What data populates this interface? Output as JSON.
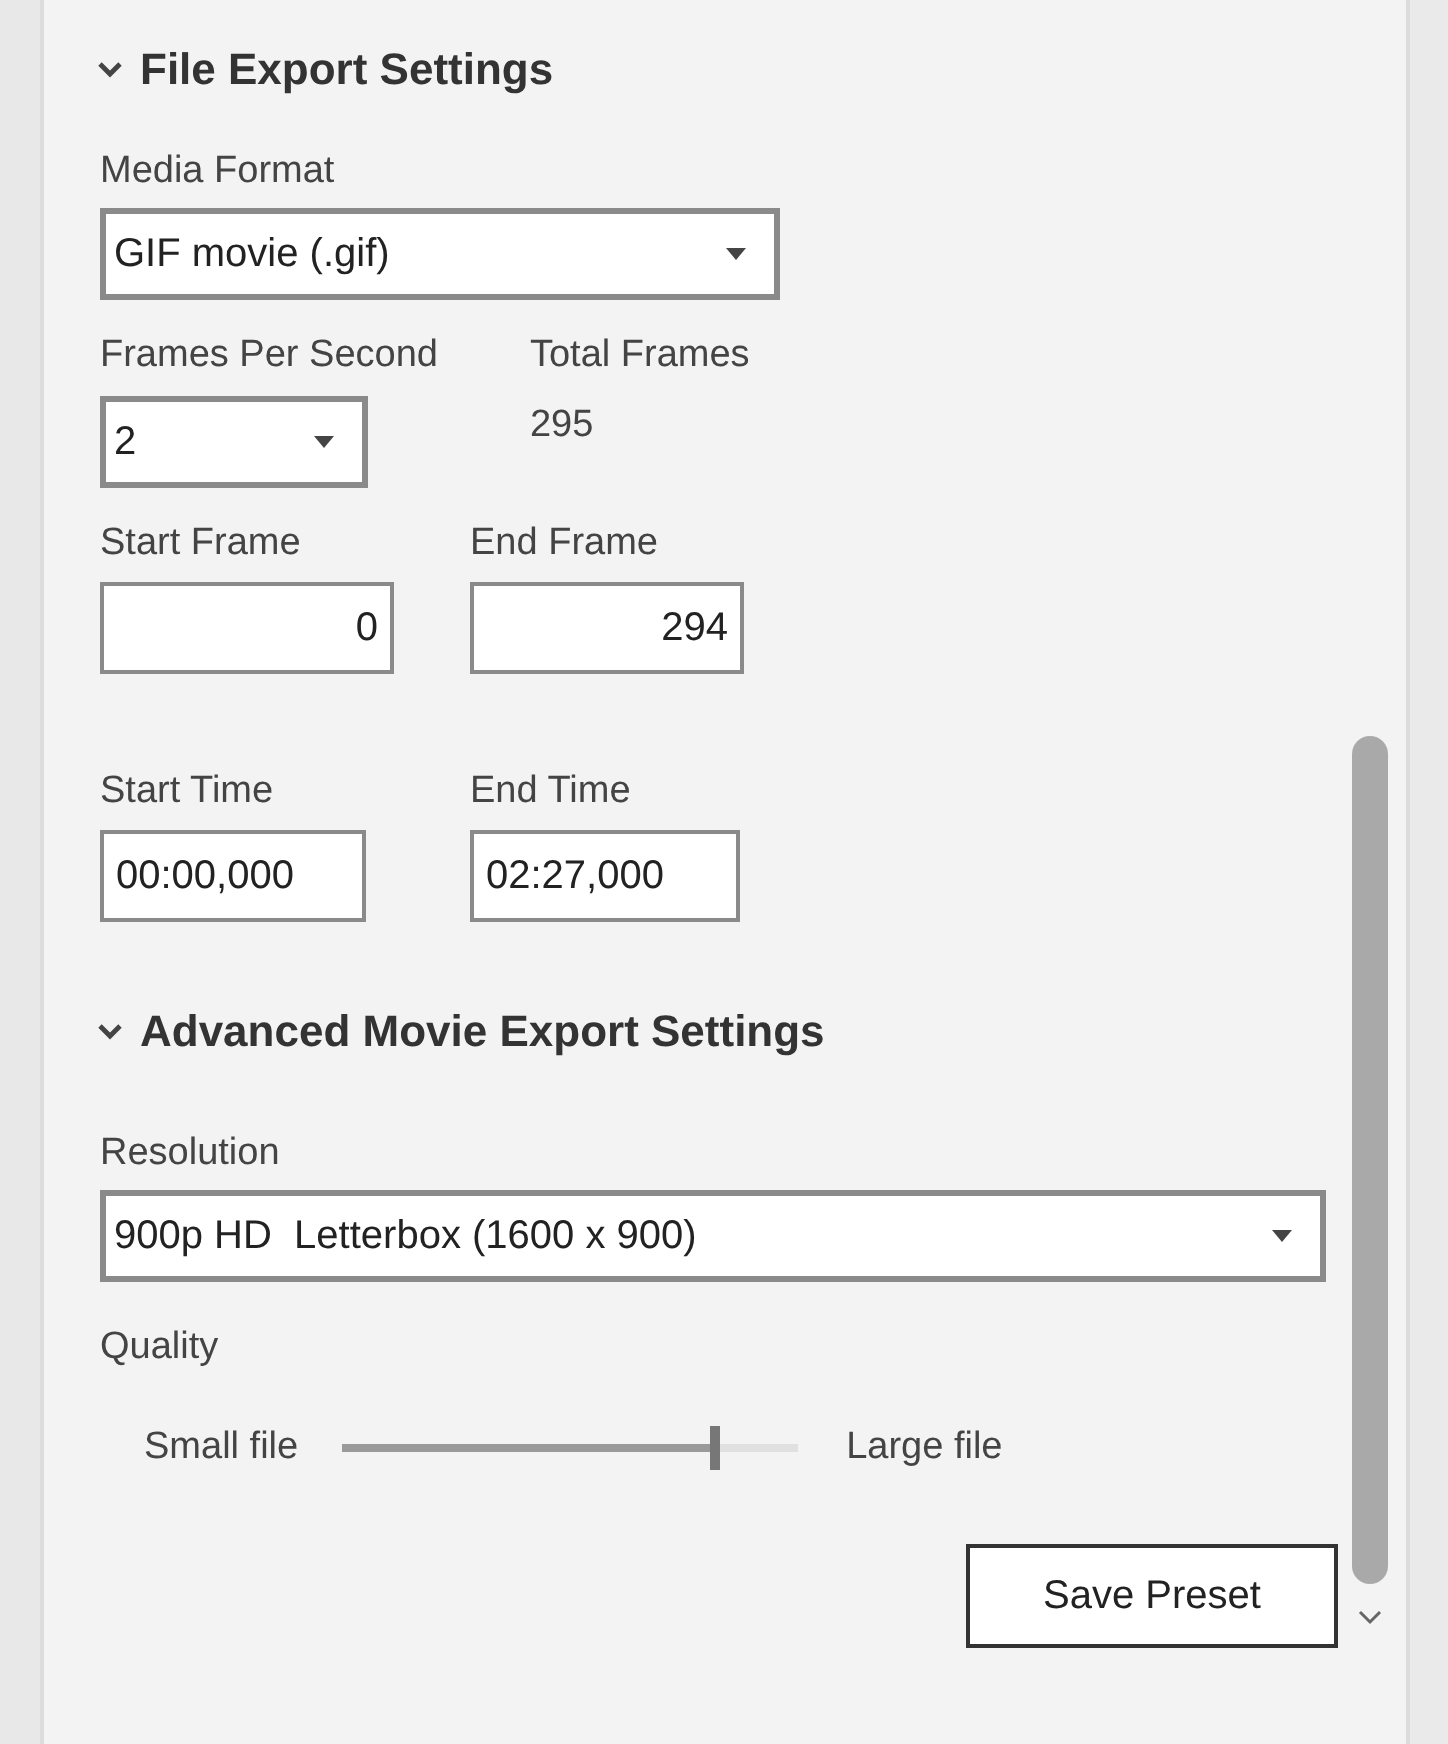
{
  "sections": [
    {
      "title": "File Export Settings",
      "expanded": true
    },
    {
      "title": "Advanced Movie Export Settings",
      "expanded": true
    }
  ],
  "media_format": {
    "label": "Media Format",
    "value": "GIF movie (.gif)"
  },
  "frames_per_second": {
    "label": "Frames Per Second",
    "value": "2"
  },
  "total_frames": {
    "label": "Total Frames",
    "value": "295"
  },
  "start_frame": {
    "label": "Start Frame",
    "value": "0"
  },
  "end_frame": {
    "label": "End Frame",
    "value": "294"
  },
  "start_time": {
    "label": "Start Time",
    "value": "00:00,000"
  },
  "end_time": {
    "label": "End Time",
    "value": "02:27,000"
  },
  "resolution": {
    "label": "Resolution",
    "value": "900p HD  Letterbox (1600 x 900)"
  },
  "quality": {
    "label": "Quality",
    "min_label": "Small file",
    "max_label": "Large file",
    "level": 0.83
  },
  "save_button": "Save Preset"
}
